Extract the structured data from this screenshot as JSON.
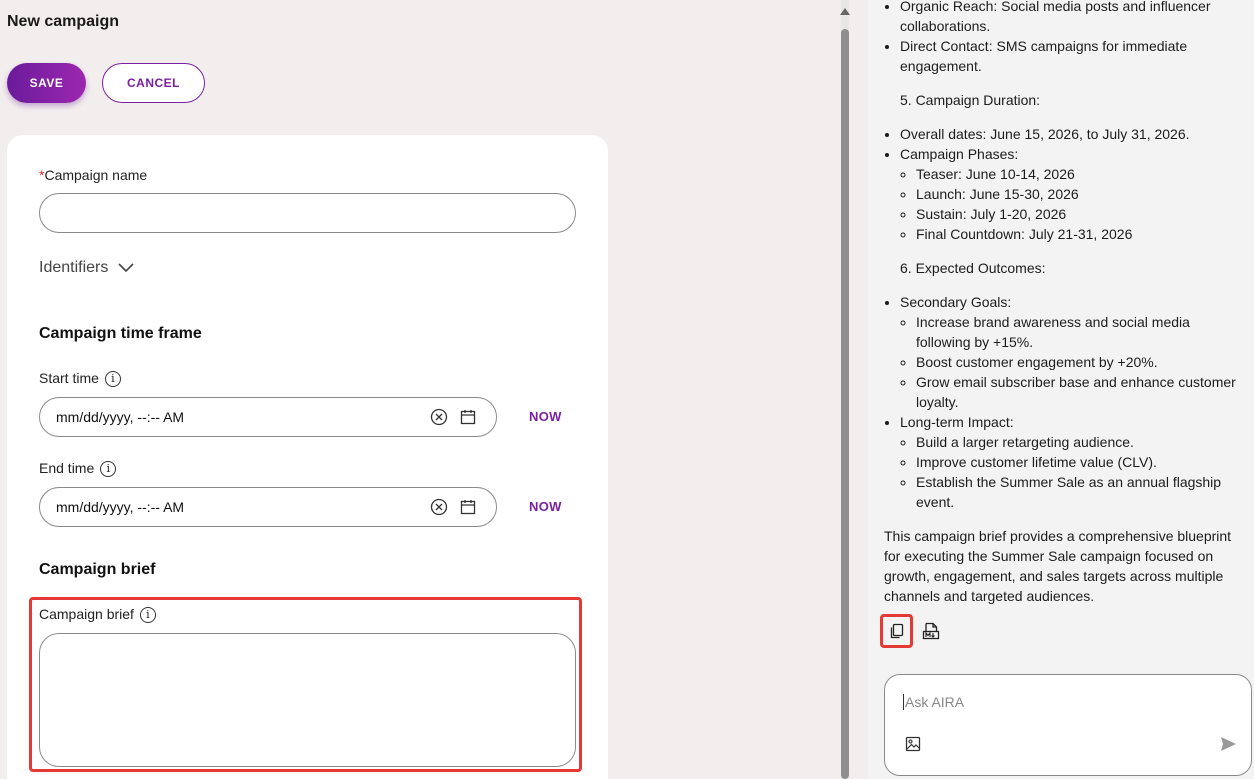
{
  "page": {
    "title": "New campaign",
    "save_label": "SAVE",
    "cancel_label": "CANCEL"
  },
  "form": {
    "campaign_name": {
      "required_marker": "*",
      "label": "Campaign name",
      "value": ""
    },
    "identifiers_label": "Identifiers",
    "timeframe": {
      "heading": "Campaign time frame",
      "start": {
        "label": "Start time",
        "placeholder": "mm/dd/yyyy, --:-- AM",
        "now_label": "NOW"
      },
      "end": {
        "label": "End time",
        "placeholder": "mm/dd/yyyy, --:-- AM",
        "now_label": "NOW"
      }
    },
    "brief": {
      "heading": "Campaign brief",
      "label": "Campaign brief",
      "value": ""
    }
  },
  "chat": {
    "top_bullets": [
      "Organic Reach: Social media posts and influencer collaborations.",
      "Direct Contact: SMS campaigns for immediate engagement."
    ],
    "duration_heading": "5. Campaign Duration:",
    "overall_dates": "Overall dates: June 15, 2026, to July 31, 2026.",
    "phases_label": "Campaign Phases:",
    "phases": [
      "Teaser: June 10-14, 2026",
      "Launch: June 15-30, 2026",
      "Sustain: July 1-20, 2026",
      "Final Countdown: July 21-31, 2026"
    ],
    "outcomes_heading": "6. Expected Outcomes:",
    "secondary_label": "Secondary Goals:",
    "secondary": [
      "Increase brand awareness and social media following by +15%.",
      "Boost customer engagement by +20%.",
      "Grow email subscriber base and enhance customer loyalty."
    ],
    "longterm_label": "Long-term Impact:",
    "longterm": [
      "Build a larger retargeting audience.",
      "Improve customer lifetime value (CLV).",
      "Establish the Summer Sale as an annual flagship event."
    ],
    "summary": "This campaign brief provides a comprehensive blueprint for executing the Summer Sale campaign focused on growth, engagement, and sales targets across multiple channels and targeted audiences.",
    "input_placeholder": "Ask AIRA"
  },
  "colors": {
    "accent": "#7b1fa2",
    "highlight": "#e53935"
  }
}
